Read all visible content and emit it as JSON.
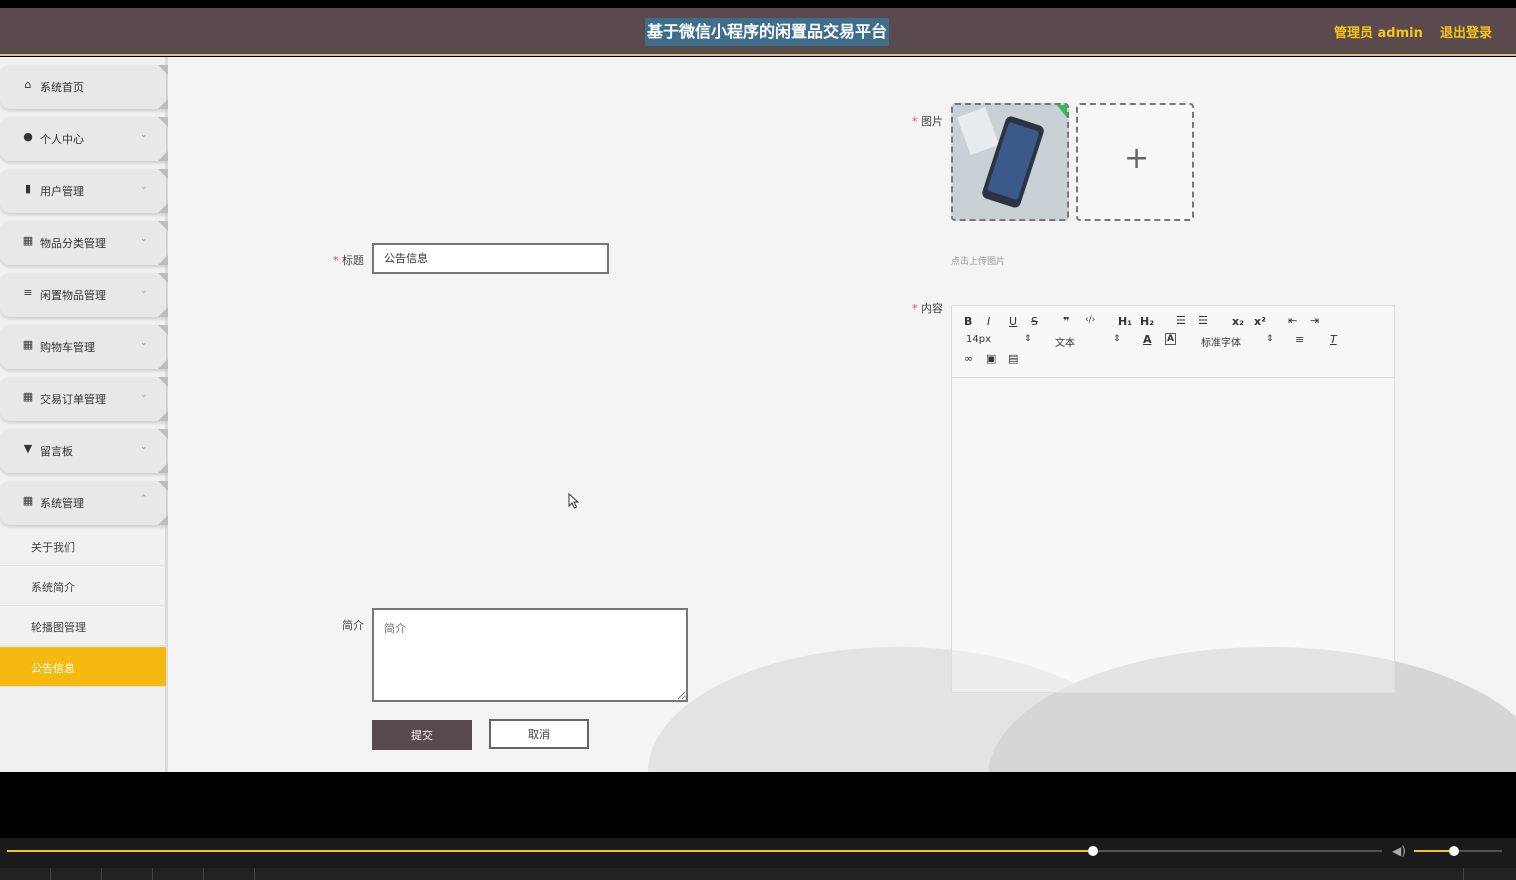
{
  "header": {
    "title": "基于微信小程序的闲置品交易平台",
    "admin_label": "管理员 admin",
    "logout_label": "退出登录"
  },
  "sidebar": {
    "items": [
      {
        "label": "系统首页",
        "icon": "home-icon"
      },
      {
        "label": "个人中心",
        "icon": "user-icon"
      },
      {
        "label": "用户管理",
        "icon": "bar-chart-icon"
      },
      {
        "label": "物品分类管理",
        "icon": "grid-icon"
      },
      {
        "label": "闲置物品管理",
        "icon": "sliders-icon"
      },
      {
        "label": "购物车管理",
        "icon": "grid-icon"
      },
      {
        "label": "交易订单管理",
        "icon": "grid-icon"
      },
      {
        "label": "留言板",
        "icon": "message-icon"
      },
      {
        "label": "系统管理",
        "icon": "grid-icon"
      }
    ],
    "sub_items": [
      {
        "label": "关于我们"
      },
      {
        "label": "系统简介"
      },
      {
        "label": "轮播图管理"
      },
      {
        "label": "公告信息",
        "active": true
      }
    ]
  },
  "form": {
    "title_label": "标题",
    "title_value": "公告信息",
    "image_label": "图片",
    "upload_hint": "点击上传图片",
    "content_label": "内容",
    "summary_label": "简介",
    "summary_placeholder": "简介",
    "submit_label": "提交",
    "cancel_label": "取消",
    "required_mark": "*"
  },
  "editor": {
    "buttons": [
      "B",
      "I",
      "U",
      "S",
      "❞",
      "‹/›",
      "H₁",
      "H₂",
      "ol",
      "ul",
      "x₂",
      "x²",
      "outdent",
      "indent"
    ],
    "font_size": "14px",
    "block_type": "文本",
    "font_family": "标准字体"
  },
  "player": {
    "progress": 0.79,
    "volume": 0.45
  }
}
